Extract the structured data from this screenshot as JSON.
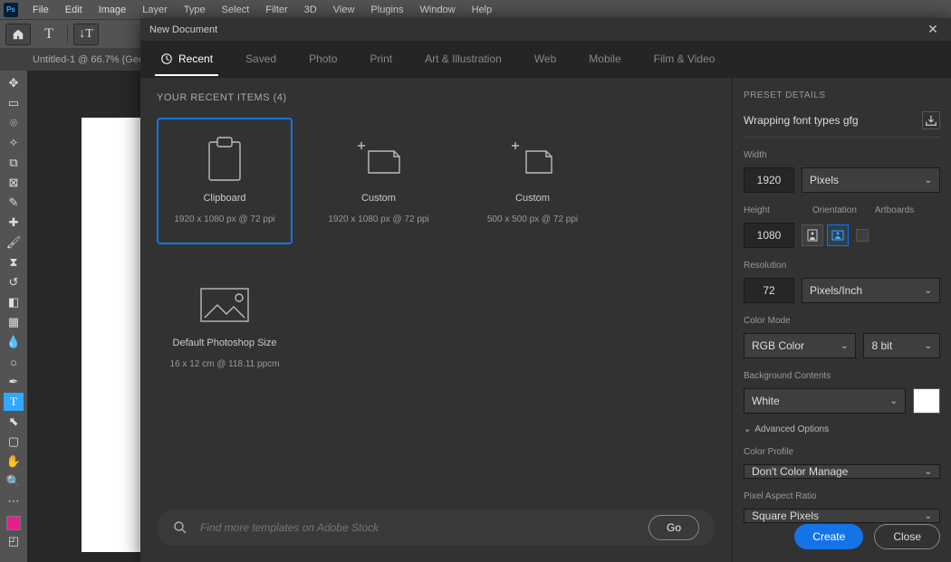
{
  "menubar": [
    "File",
    "Edit",
    "Image",
    "Layer",
    "Type",
    "Select",
    "Filter",
    "3D",
    "View",
    "Plugins",
    "Window",
    "Help"
  ],
  "app_logo": "Ps",
  "doc_tab": "Untitled-1 @ 66.7% (Gee...",
  "dialog": {
    "title": "New Document",
    "tabs": [
      "Recent",
      "Saved",
      "Photo",
      "Print",
      "Art & Illustration",
      "Web",
      "Mobile",
      "Film & Video"
    ],
    "active_tab": "Recent",
    "recent_header": "YOUR RECENT ITEMS  (4)",
    "presets": [
      {
        "title": "Clipboard",
        "sub": "1920 x 1080 px @ 72 ppi"
      },
      {
        "title": "Custom",
        "sub": "1920 x 1080 px @ 72 ppi"
      },
      {
        "title": "Custom",
        "sub": "500 x 500 px @ 72 ppi"
      },
      {
        "title": "Default Photoshop Size",
        "sub": "16 x 12 cm @ 118.11 ppcm"
      }
    ],
    "search_placeholder": "Find more templates on Adobe Stock",
    "go_label": "Go"
  },
  "details": {
    "header": "PRESET DETAILS",
    "name": "Wrapping font types gfg",
    "width_label": "Width",
    "width_value": "1920",
    "width_unit": "Pixels",
    "height_label": "Height",
    "height_value": "1080",
    "orientation_label": "Orientation",
    "artboards_label": "Artboards",
    "resolution_label": "Resolution",
    "resolution_value": "72",
    "resolution_unit": "Pixels/Inch",
    "colormode_label": "Color Mode",
    "colormode_value": "RGB Color",
    "bitdepth_value": "8 bit",
    "bgcontents_label": "Background Contents",
    "bgcontents_value": "White",
    "advanced_label": "Advanced Options",
    "colorprofile_label": "Color Profile",
    "colorprofile_value": "Don't Color Manage",
    "pixelaspect_label": "Pixel Aspect Ratio",
    "pixelaspect_value": "Square Pixels",
    "create_label": "Create",
    "close_label": "Close"
  }
}
